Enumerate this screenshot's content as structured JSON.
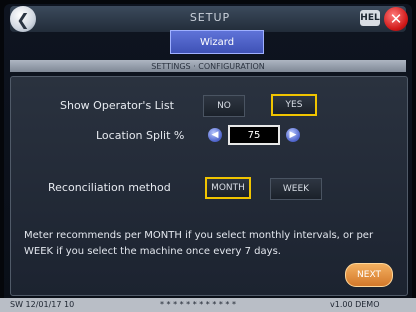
{
  "title_bar": {
    "back_symbol": "❮",
    "title": "SETUP",
    "help_label": "HEL",
    "close_symbol": "✕"
  },
  "tab": {
    "label": "Wizard"
  },
  "section": {
    "label": "SETTINGS · CONFIGURATION"
  },
  "form": {
    "show_operators_label": "Show Operator's List",
    "show_operators_options": [
      "NO",
      "YES"
    ],
    "show_operators_selected": "YES",
    "location_split_label": "Location Split %",
    "location_split_value": "75",
    "reconciliation_label": "Reconciliation method",
    "reconciliation_options": [
      "MONTH",
      "WEEK"
    ],
    "reconciliation_selected": "MONTH"
  },
  "info_text": "Meter recommends per MONTH if you select monthly intervals, or per WEEK if you select the machine once every 7 days.",
  "next_button": {
    "label": "NEXT"
  },
  "status_bar": {
    "left": "SW 12/01/17 10",
    "center": "* * * * * * * * * * * *",
    "right": "v1.00 DEMO"
  },
  "colors": {
    "accent_tab": "#4a5ed0",
    "selected_outline": "#f0c400",
    "next_button": "#e8964a",
    "close_button": "#d01818"
  }
}
